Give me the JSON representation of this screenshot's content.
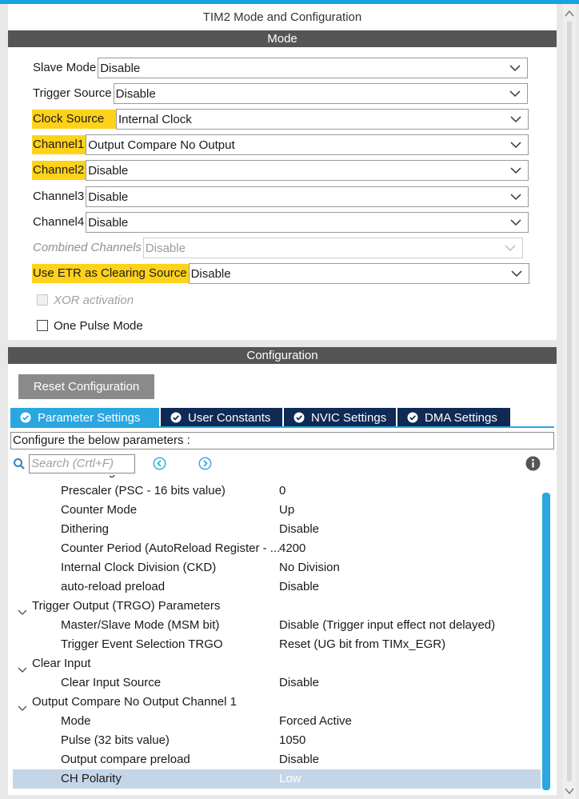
{
  "window": {
    "title": "TIM2 Mode and Configuration"
  },
  "mode": {
    "header": "Mode",
    "fields": [
      {
        "label": "Slave Mode",
        "value": "Disable"
      },
      {
        "label": "Trigger Source",
        "value": "Disable"
      },
      {
        "label": "Clock Source",
        "value": "Internal Clock"
      },
      {
        "label": "Channel1",
        "value": "Output Compare No Output"
      },
      {
        "label": "Channel2",
        "value": "Disable"
      },
      {
        "label": "Channel3",
        "value": "Disable"
      },
      {
        "label": "Channel4",
        "value": "Disable"
      },
      {
        "label": "Combined Channels",
        "value": "Disable"
      },
      {
        "label": "Use ETR as Clearing Source",
        "value": "Disable"
      }
    ],
    "checkboxes": [
      {
        "label": "XOR activation"
      },
      {
        "label": "One Pulse Mode"
      }
    ]
  },
  "configuration": {
    "header": "Configuration",
    "reset_label": "Reset Configuration",
    "tabs": [
      {
        "label": "Parameter Settings"
      },
      {
        "label": "User Constants"
      },
      {
        "label": "NVIC Settings"
      },
      {
        "label": "DMA Settings"
      }
    ],
    "description": "Configure the below parameters :",
    "search_placeholder": "Search (Crtl+F)",
    "partial_group": "Counter Settings",
    "rows": [
      {
        "key": "Prescaler (PSC - 16 bits value)",
        "value": "0"
      },
      {
        "key": "Counter Mode",
        "value": "Up"
      },
      {
        "key": "Dithering",
        "value": "Disable"
      },
      {
        "key": "Counter Period (AutoReload Register - ...",
        "value": "4200"
      },
      {
        "key": "Internal Clock Division (CKD)",
        "value": "No Division"
      },
      {
        "key": "auto-reload preload",
        "value": "Disable"
      },
      {
        "key": "Trigger Output (TRGO) Parameters",
        "value": ""
      },
      {
        "key": "Master/Slave Mode (MSM bit)",
        "value": "Disable (Trigger input effect not delayed)"
      },
      {
        "key": "Trigger Event Selection TRGO",
        "value": "Reset (UG bit from TIMx_EGR)"
      },
      {
        "key": "Clear Input",
        "value": ""
      },
      {
        "key": "Clear Input Source",
        "value": "Disable"
      },
      {
        "key": "Output Compare No Output Channel 1",
        "value": ""
      },
      {
        "key": "Mode",
        "value": "Forced Active"
      },
      {
        "key": "Pulse (32 bits value)",
        "value": "1050"
      },
      {
        "key": "Output compare preload",
        "value": "Disable"
      },
      {
        "key": "CH Polarity",
        "value": "Low"
      }
    ]
  },
  "colors": {
    "highlight": "#ffd21a",
    "header_bar": "#555555",
    "tab_active": "#2aa6e0",
    "tab_inactive": "#0f2a54",
    "selected_row": "#c5d5e8"
  }
}
